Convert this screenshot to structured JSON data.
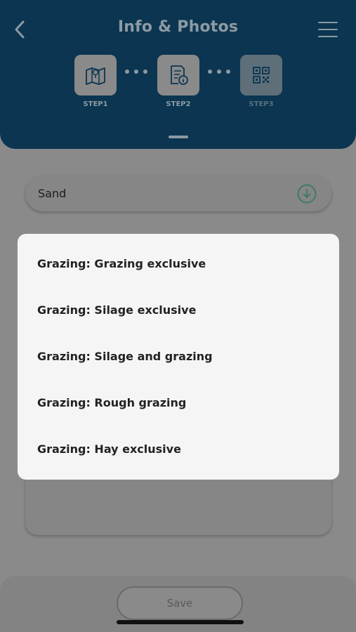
{
  "header": {
    "title": "Info & Photos",
    "steps": [
      {
        "label": "STEP1",
        "icon": "map-icon"
      },
      {
        "label": "STEP2",
        "icon": "document-info-icon"
      },
      {
        "label": "STEP3",
        "icon": "qr-code-icon"
      }
    ]
  },
  "form": {
    "soil_type_value": "Sand"
  },
  "dropdown": {
    "options": [
      "Grazing: Grazing exclusive",
      "Grazing: Silage exclusive",
      "Grazing: Silage and grazing",
      "Grazing: Rough grazing",
      "Grazing: Hay exclusive"
    ]
  },
  "footer": {
    "save_label": "Save"
  },
  "colors": {
    "header_bg": "#0b3550",
    "overlay_bg": "#8a8a8a",
    "popup_bg": "#f5f5f5",
    "accent_green": "#3e7a6a"
  }
}
